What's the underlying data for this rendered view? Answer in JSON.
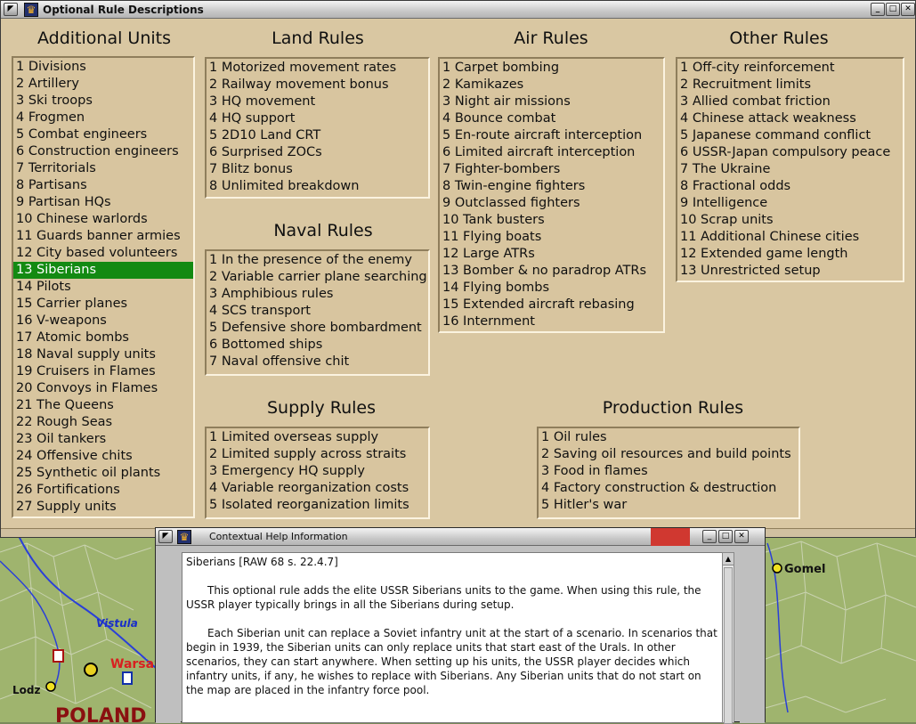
{
  "main_window": {
    "title": "Optional Rule Descriptions",
    "sections": {
      "additional_units": {
        "heading": "Additional Units",
        "items": [
          "1 Divisions",
          "2 Artillery",
          "3 Ski troops",
          "4 Frogmen",
          "5 Combat engineers",
          "6 Construction engineers",
          "7 Territorials",
          "8 Partisans",
          "9 Partisan HQs",
          "10 Chinese warlords",
          "11 Guards banner armies",
          "12 City based volunteers",
          "13 Siberians",
          "14 Pilots",
          "15 Carrier planes",
          "16 V-weapons",
          "17 Atomic bombs",
          "18 Naval supply units",
          "19 Cruisers in Flames",
          "20 Convoys in Flames",
          "21 The Queens",
          "22 Rough Seas",
          "23 Oil tankers",
          "24 Offensive chits",
          "25 Synthetic oil plants",
          "26 Fortifications",
          "27 Supply units"
        ],
        "selected_index": 12
      },
      "land_rules": {
        "heading": "Land Rules",
        "items": [
          "1 Motorized movement rates",
          "2 Railway movement bonus",
          "3 HQ movement",
          "4 HQ support",
          "5 2D10 Land CRT",
          "6 Surprised ZOCs",
          "7 Blitz bonus",
          "8 Unlimited breakdown"
        ]
      },
      "naval_rules": {
        "heading": "Naval Rules",
        "items": [
          "1 In the presence of the enemy",
          "2 Variable carrier plane searching",
          "3 Amphibious rules",
          "4 SCS transport",
          "5 Defensive shore bombardment",
          "6 Bottomed ships",
          "7 Naval offensive chit"
        ]
      },
      "supply_rules": {
        "heading": "Supply Rules",
        "items": [
          "1 Limited overseas supply",
          "2 Limited supply across straits",
          "3 Emergency HQ supply",
          "4 Variable reorganization costs",
          "5 Isolated reorganization limits"
        ]
      },
      "air_rules": {
        "heading": "Air Rules",
        "items": [
          "1 Carpet bombing",
          "2 Kamikazes",
          "3 Night air missions",
          "4 Bounce combat",
          "5 En-route aircraft interception",
          "6 Limited aircraft interception",
          "7 Fighter-bombers",
          "8 Twin-engine fighters",
          "9 Outclassed fighters",
          "10 Tank busters",
          "11 Flying boats",
          "12 Large ATRs",
          "13 Bomber & no paradrop ATRs",
          "14 Flying bombs",
          "15 Extended aircraft rebasing",
          "16 Internment"
        ]
      },
      "other_rules": {
        "heading": "Other Rules",
        "items": [
          "1 Off-city reinforcement",
          "2 Recruitment limits",
          "3 Allied combat friction",
          "4 Chinese attack weakness",
          "5 Japanese command conflict",
          "6 USSR-Japan compulsory peace",
          "7 The Ukraine",
          "8 Fractional odds",
          "9 Intelligence",
          "10 Scrap units",
          "11 Additional Chinese cities",
          "12 Extended game length",
          "13 Unrestricted setup"
        ]
      },
      "production_rules": {
        "heading": "Production Rules",
        "items": [
          "1 Oil rules",
          "2 Saving oil resources and build points",
          "3 Food in flames",
          "4 Factory construction & destruction",
          "5 Hitler's war"
        ]
      }
    }
  },
  "help_window": {
    "title": "Contextual Help Information",
    "heading": "Siberians [RAW 68 s. 22.4.7]",
    "paragraph1": "This optional rule adds the elite USSR Siberians units to the game.  When using this rule, the USSR player typically brings in all the Siberians during setup.",
    "paragraph2": "Each Siberian unit can replace a Soviet infantry unit at the start of a scenario.  In scenarios that begin in 1939, the Siberian units can only replace units that start east of the Urals. In other scenarios, they can start anywhere.  When setting up his units, the USSR player decides which infantry units, if any, he wishes to replace with Siberians. Any Siberian units that do not start on the map are placed in the infantry force pool."
  },
  "map": {
    "labels": {
      "vistula": "Vistula",
      "warsaw": "Warsaw",
      "lodz": "Lodz",
      "poland": "POLAND",
      "gomel": "Gomel"
    }
  },
  "icons": {
    "minimize": "minimize-icon",
    "maximize": "maximize-icon",
    "close": "close-icon",
    "menu": "system-menu-icon",
    "app": "app-icon"
  },
  "colors": {
    "panel_background": "#d9c7a2",
    "selection": "#138a12",
    "map_land": "#9fb46e",
    "river": "#2a3fd8",
    "city_label_warsaw": "#d82020"
  },
  "glyphs": {
    "minimize": "_",
    "maximize": "□",
    "close": "✕",
    "menu": "◤",
    "app": "♛",
    "scroll_up": "▲"
  }
}
